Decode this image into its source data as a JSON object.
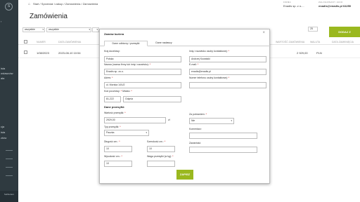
{
  "sidebar": {
    "logo": "S",
    "items": [
      "ista",
      "ostawców",
      "ała"
    ],
    "items_lower": [
      "cja",
      "ista",
      "ztów"
    ],
    "bottom": "Sellbudero"
  },
  "topbar": {
    "home_icon": "home-icon",
    "breadcrumb": "Start  /  Sprzedaż i zakup  /  Zamówienia  /  Zamówienia",
    "firma_label": "FIRMA",
    "firma_value": "Enadis sp. z o....",
    "zalogowany_label": "ZALOGOWANY JAKO",
    "zalogowany_value": "enadis@enadis.pl  64250"
  },
  "page_title": "Zamówienia",
  "filters": [
    "wszystkie",
    "wszystkie"
  ],
  "per_page": "25",
  "add_button": "DODAJ Z",
  "table": {
    "headers": [
      "NUMER",
      "DATA ZAMÓWIENIA",
      "WARTOŚĆ ZAMÓWIENIA",
      "WALUTA",
      "DATA ZAMKNIĘCIA"
    ],
    "row": [
      "1/08/2023",
      "2023-08-10 10:54",
      "2 929,00",
      "PLN"
    ]
  },
  "modal": {
    "title": "Zamów kuriera",
    "close_icon": "close-icon",
    "tabs": [
      "Dane odbiorcy i przesyłki",
      "Dane nadawcy"
    ],
    "fields": {
      "kraj_label": "Kraj docelowy:",
      "kraj_value": "Polska",
      "nazwa_label": "Nazwa (nazwa firmy lub imię i nazwisko):",
      "nazwa_value": "Enadis sp. zo.o.",
      "adres_label": "Adres:",
      "adres_value": "ul. Morska 14/U2",
      "kod_label": "Kod pocztowy:",
      "miasto_label": "Miasto:",
      "kod_value": "81-222",
      "miasto_value": "Gdynia",
      "osoba_label": "Imię i nazwisko osoby kontaktowej:",
      "osoba_value": "Andrzej Kowalski",
      "email_label": "E-mail:",
      "email_value": "enadis@enadis.pl",
      "tel_label": "Numer telefonu osoby kontaktowej:",
      "tel_value": ""
    },
    "parcel_section": "Dane przesyłki:",
    "parcel": {
      "wartosc_label": "Wartość przesyłki:",
      "wartosc_value": "2929,00",
      "currency": "zł",
      "typ_label": "Typ przesyłki:",
      "typ_value": "Paczka",
      "dlugosc_label": "Długość cm.:",
      "dlugosc_value": "10",
      "szerokosc_label": "Szerokość cm.:",
      "szerokosc_value": "10",
      "wysokosc_label": "Wysokość cm.:",
      "wysokosc_value": "10",
      "waga_label": "Waga przesyłki (w kg):",
      "waga_value": "",
      "pobranie_label": "Za pobraniem:",
      "pobranie_value": "Nie",
      "komentarz_label": "Komentarz:",
      "komentarz_value": "",
      "zawartosc_label": "Zawartość:",
      "zawartosc_value": ""
    },
    "required_mark": "*",
    "save_button": "ZAPISZ"
  },
  "colors": {
    "sidebar": "#2f3a40",
    "accent": "#9ab81f"
  }
}
